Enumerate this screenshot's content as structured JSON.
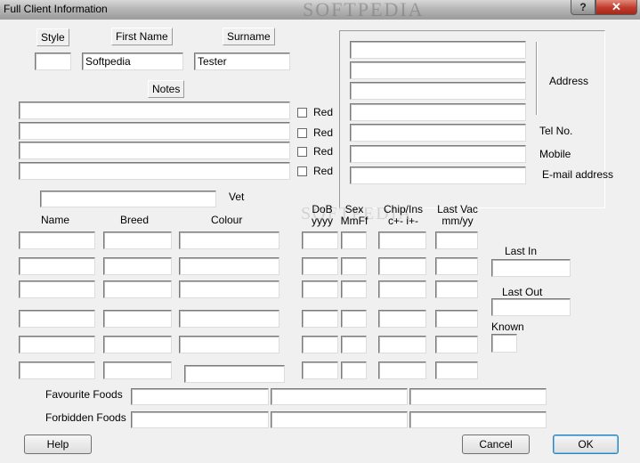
{
  "window": {
    "title": "Full Client Information",
    "watermark": "SOFTPEDIA",
    "help_glyph": "?",
    "close_glyph": "✕"
  },
  "client": {
    "style_label": "Style",
    "style_value": "",
    "first_name_label": "First Name",
    "first_name_value": "Softpedia",
    "surname_label": "Surname",
    "surname_value": "Tester",
    "notes_label": "Notes",
    "red_label": "Red"
  },
  "contact": {
    "address_label": "Address",
    "tel_label": "Tel No.",
    "mobile_label": "Mobile",
    "email_label": "E-mail address"
  },
  "pets": {
    "vet_label": "Vet",
    "columns": {
      "name": "Name",
      "breed": "Breed",
      "colour": "Colour",
      "dob": "DoB\nyyyy",
      "sex": "Sex\nMmFf",
      "chip": "Chip/Ins\nc+- i+-",
      "lastvac": "Last Vac\nmm/yy"
    },
    "last_in_label": "Last In",
    "last_out_label": "Last Out",
    "known_label": "Known"
  },
  "foods": {
    "favourite_label": "Favourite Foods",
    "forbidden_label": "Forbidden Foods"
  },
  "buttons": {
    "help": "Help",
    "cancel": "Cancel",
    "ok": "OK"
  }
}
